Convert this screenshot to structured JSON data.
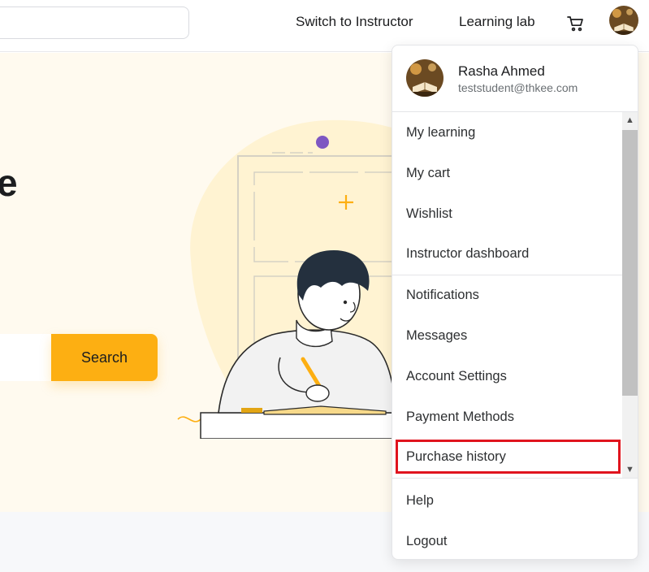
{
  "header": {
    "search_value": "",
    "switch_instructor": "Switch to Instructor",
    "learning_lab": "Learning lab",
    "cart_icon": "cart-icon"
  },
  "hero": {
    "heading_fragment": "e",
    "search_button": "Search"
  },
  "user_menu": {
    "user_name": "Rasha Ahmed",
    "user_email": "teststudent@thkee.com",
    "group1": [
      "My learning",
      "My cart",
      "Wishlist",
      "Instructor dashboard"
    ],
    "group2": [
      "Notifications",
      "Messages",
      "Account Settings",
      "Payment Methods",
      "Purchase history"
    ],
    "group3": [
      "Help",
      "Logout"
    ],
    "highlighted_item": "Purchase history",
    "scroll_up_icon": "▲",
    "scroll_down_icon": "▼"
  },
  "colors": {
    "accent": "#fdaf12",
    "highlight_border": "#e0141e",
    "hero_bg": "#fffaef",
    "illustration_purple": "#7e57c2"
  }
}
